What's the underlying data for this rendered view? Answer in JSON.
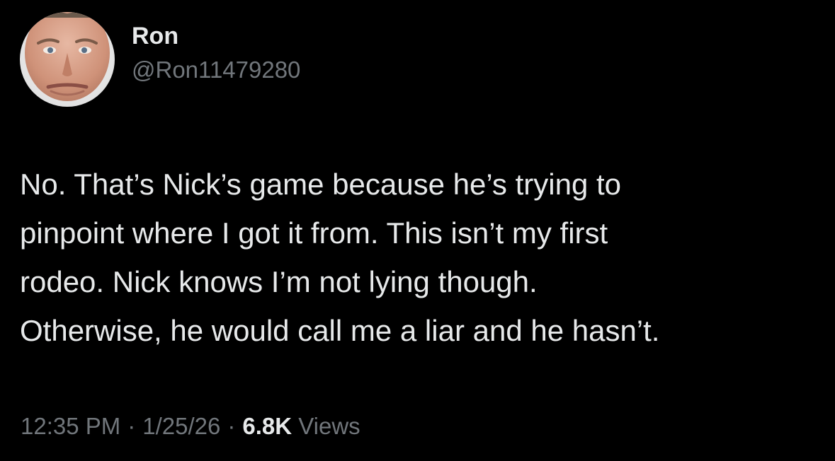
{
  "author": {
    "display_name": "Ron",
    "handle": "@Ron11479280"
  },
  "tweet": {
    "text": "No. That’s Nick’s game because he’s trying to\npinpoint where I got it from. This isn’t my first\nrodeo. Nick knows I’m not lying though.\nOtherwise, he would call me a liar and he hasn’t."
  },
  "meta": {
    "time": "12:35 PM",
    "date": "1/25/26",
    "separator": "·",
    "views_count": "6.8K",
    "views_label": "Views"
  },
  "colors": {
    "background": "#000000",
    "primary_text": "#e7e9ea",
    "secondary_text": "#71767b"
  }
}
